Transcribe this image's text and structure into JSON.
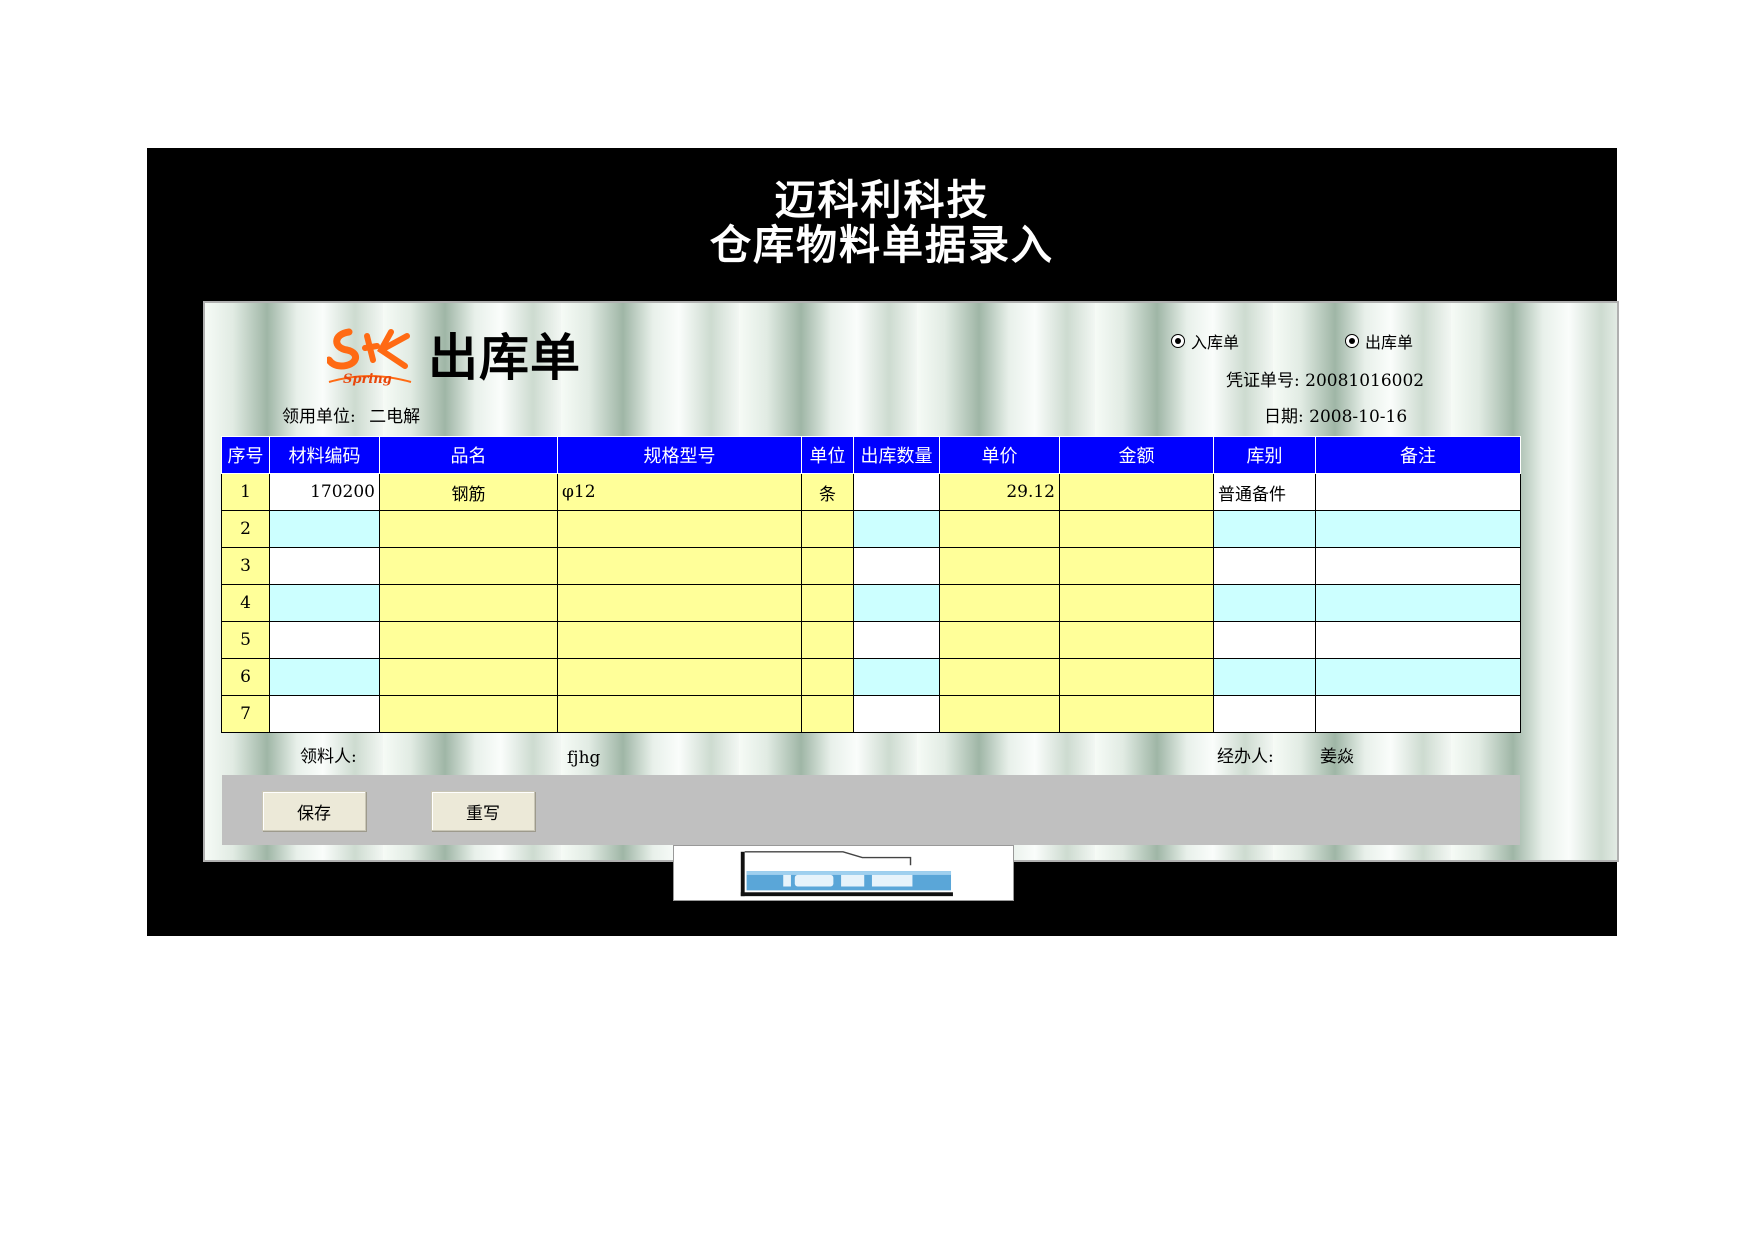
{
  "header": {
    "company": "迈科利科技",
    "subtitle": "仓库物料单据录入"
  },
  "form": {
    "logo_text": "Spring",
    "title": "出库单",
    "radio_in_label": "入库单",
    "radio_out_label": "出库单",
    "voucher_label": "凭证单号:",
    "voucher_value": "20081016002",
    "date_label": "日期:",
    "date_value": "2008-10-16",
    "dept_label": "领用单位:",
    "dept_value": "二电解"
  },
  "table": {
    "headers": [
      "序号",
      "材料编码",
      "品名",
      "规格型号",
      "单位",
      "出库数量",
      "单价",
      "金额",
      "库别",
      "备注"
    ],
    "rows": [
      {
        "idx": "1",
        "code": "170200",
        "name": "钢筋",
        "spec": "φ12",
        "unit": "条",
        "qty": "",
        "price": "29.12",
        "amount": "",
        "store": "普通备件",
        "note": ""
      },
      {
        "idx": "2",
        "code": "",
        "name": "",
        "spec": "",
        "unit": "",
        "qty": "",
        "price": "",
        "amount": "",
        "store": "",
        "note": ""
      },
      {
        "idx": "3",
        "code": "",
        "name": "",
        "spec": "",
        "unit": "",
        "qty": "",
        "price": "",
        "amount": "",
        "store": "",
        "note": ""
      },
      {
        "idx": "4",
        "code": "",
        "name": "",
        "spec": "",
        "unit": "",
        "qty": "",
        "price": "",
        "amount": "",
        "store": "",
        "note": ""
      },
      {
        "idx": "5",
        "code": "",
        "name": "",
        "spec": "",
        "unit": "",
        "qty": "",
        "price": "",
        "amount": "",
        "store": "",
        "note": ""
      },
      {
        "idx": "6",
        "code": "",
        "name": "",
        "spec": "",
        "unit": "",
        "qty": "",
        "price": "",
        "amount": "",
        "store": "",
        "note": ""
      },
      {
        "idx": "7",
        "code": "",
        "name": "",
        "spec": "",
        "unit": "",
        "qty": "",
        "price": "",
        "amount": "",
        "store": "",
        "note": ""
      }
    ]
  },
  "footer": {
    "receiver_label": "领料人:",
    "receiver_value": "fjhg",
    "handler_label": "经办人:",
    "handler_value": "姜焱"
  },
  "buttons": {
    "save": "保存",
    "reset": "重写"
  },
  "colors": {
    "header_blue": "#0000ff",
    "cell_yellow": "#ffff99",
    "cell_cyan": "#ccffff",
    "board_black": "#000000",
    "logo_orange": "#ff6a13"
  }
}
